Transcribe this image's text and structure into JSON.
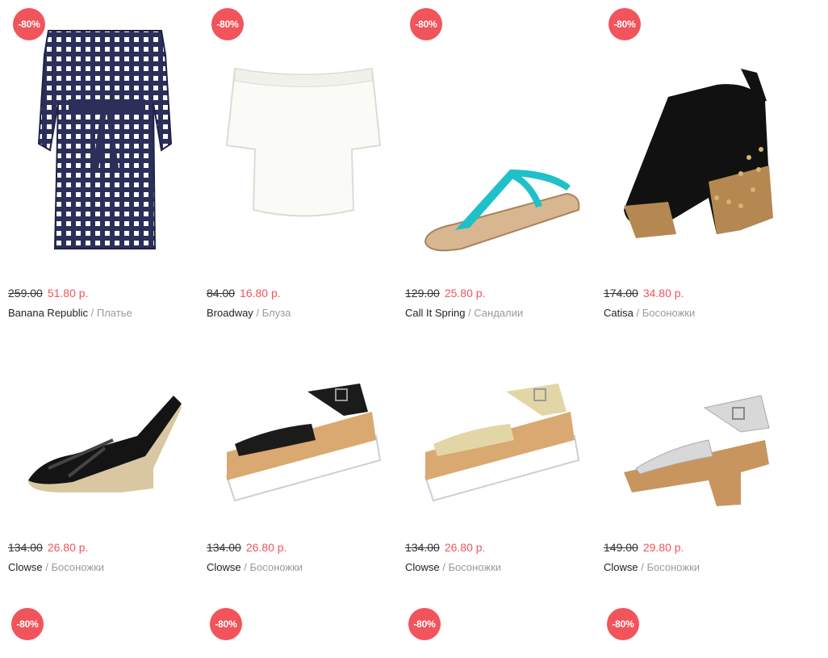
{
  "colors": {
    "badge": "#f1545b",
    "new_price": "#f1545b",
    "category": "#9a9a9a"
  },
  "products": [
    {
      "badge": "-80%",
      "old_price": "259.00",
      "new_price": "51.80 р.",
      "brand": "Banana Republic",
      "category": "/ Платье",
      "image": "gingham-dress"
    },
    {
      "badge": "-80%",
      "old_price": "84.00",
      "new_price": "16.80 р.",
      "brand": "Broadway",
      "category": "/ Блуза",
      "image": "white-blouse"
    },
    {
      "badge": "-80%",
      "old_price": "129.00",
      "new_price": "25.80 р.",
      "brand": "Call It Spring",
      "category": "/ Сандалии",
      "image": "turquoise-sandal"
    },
    {
      "badge": "-80%",
      "old_price": "174.00",
      "new_price": "34.80 р.",
      "brand": "Catisa",
      "category": "/ Босоножки",
      "image": "black-clog-sandal"
    },
    {
      "old_price": "134.00",
      "new_price": "26.80 р.",
      "brand": "Clowse",
      "category": "/ Босоножки",
      "image": "black-espadrille-wedge"
    },
    {
      "old_price": "134.00",
      "new_price": "26.80 р.",
      "brand": "Clowse",
      "category": "/ Босоножки",
      "image": "black-platform-sandal"
    },
    {
      "old_price": "134.00",
      "new_price": "26.80 р.",
      "brand": "Clowse",
      "category": "/ Босоножки",
      "image": "gold-platform-sandal"
    },
    {
      "old_price": "149.00",
      "new_price": "29.80 р.",
      "brand": "Clowse",
      "category": "/ Босоножки",
      "image": "silver-block-sandal"
    },
    {
      "badge": "-80%"
    },
    {
      "badge": "-80%"
    },
    {
      "badge": "-80%"
    },
    {
      "badge": "-80%"
    }
  ]
}
